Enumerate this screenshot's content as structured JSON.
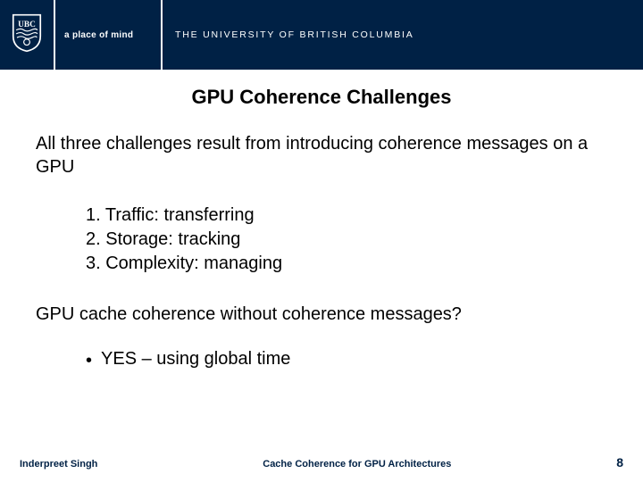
{
  "header": {
    "tagline": "a place of mind",
    "university": "THE UNIVERSITY OF BRITISH COLUMBIA"
  },
  "title": "GPU Coherence Challenges",
  "intro": "All three challenges result from introducing coherence messages on a GPU",
  "numbered": [
    "1. Traffic: transferring",
    "2. Storage: tracking",
    "3. Complexity: managing"
  ],
  "question": "GPU cache coherence without coherence messages?",
  "answer_bullet": "YES – using global time",
  "footer": {
    "author": "Inderpreet Singh",
    "subject": "Cache Coherence for GPU Architectures",
    "page": "8"
  }
}
